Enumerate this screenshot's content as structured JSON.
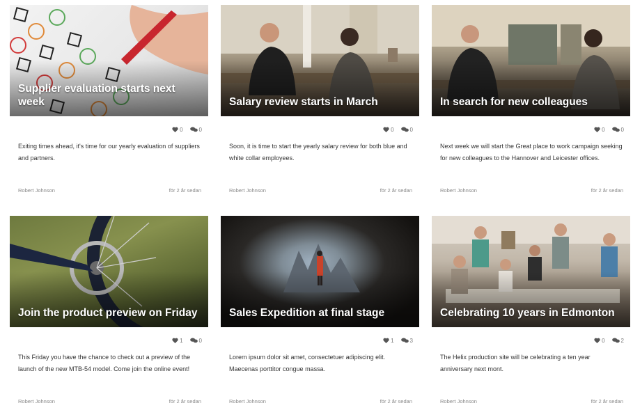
{
  "cards": [
    {
      "title": "Supplier evaluation starts next week",
      "likes": "0",
      "comments": "0",
      "excerpt": "Exiting times ahead, it's time for our yearly evaluation of suppliers and partners.",
      "author": "Robert Johnson",
      "time": "för 2 år sedan"
    },
    {
      "title": "Salary review starts in March",
      "likes": "0",
      "comments": "0",
      "excerpt": "Soon, it is time to start the yearly salary review for both blue and white collar employees.",
      "author": "Robert Johnson",
      "time": "för 2 år sedan"
    },
    {
      "title": "In search for new colleagues",
      "likes": "0",
      "comments": "0",
      "excerpt": "Next week we will start the Great place to work campaign seeking for new colleagues to the Hannover and Leicester offices.",
      "author": "Robert Johnson",
      "time": "för 2 år sedan"
    },
    {
      "title": "Join the product preview on Friday",
      "likes": "1",
      "comments": "0",
      "excerpt": "This Friday you have the chance to check out a preview of the launch of the new MTB-54 model. Come join the online event!",
      "author": "Robert Johnson",
      "time": "för 2 år sedan"
    },
    {
      "title": "Sales Expedition at final stage",
      "likes": "1",
      "comments": "3",
      "excerpt": "Lorem ipsum dolor sit amet, consectetuer adipiscing elit. Maecenas porttitor congue massa.",
      "author": "Robert Johnson",
      "time": "för 2 år sedan"
    },
    {
      "title": "Celebrating 10 years in Edmonton",
      "likes": "0",
      "comments": "2",
      "excerpt": "The Helix production site will be celebrating a ten year anniversary next mont.",
      "author": "Robert Johnson",
      "time": "för 2 år sedan"
    }
  ],
  "icons": {
    "like": "heart-icon",
    "comment": "comment-bubbles-icon"
  },
  "colors": {
    "icon": "#555555",
    "title_text": "#ffffff",
    "body_text": "#333333",
    "meta_text": "#888888"
  }
}
